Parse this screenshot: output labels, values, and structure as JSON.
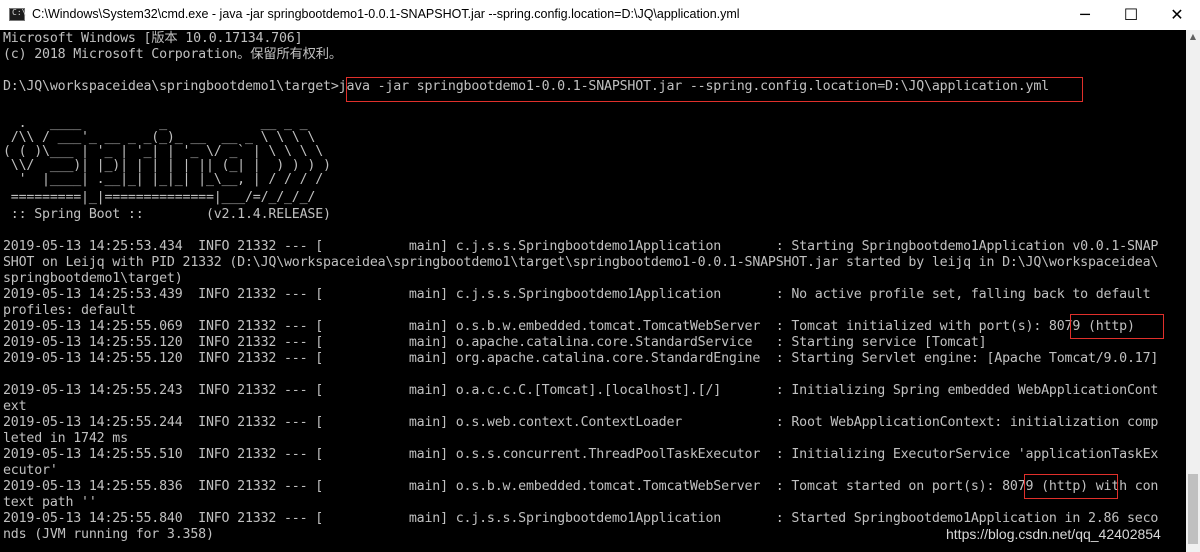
{
  "window": {
    "title": "C:\\Windows\\System32\\cmd.exe - java  -jar springbootdemo1-0.0.1-SNAPSHOT.jar --spring.config.location=D:\\JQ\\application.yml",
    "icon": "cmd-icon",
    "icon_text": "C:\\",
    "minimize_label": "─",
    "maximize_label": "☐",
    "close_label": "✕"
  },
  "console": {
    "lines": [
      "Microsoft Windows [版本 10.0.17134.706]",
      "(c) 2018 Microsoft Corporation。保留所有权利。",
      "",
      "D:\\JQ\\workspaceidea\\springbootdemo1\\target>java -jar springbootdemo1-0.0.1-SNAPSHOT.jar --spring.config.location=D:\\JQ\\application.yml",
      "",
      "  .   ____          _            __ _ _",
      " /\\\\ / ___'_ __ _ _(_)_ __  __ _ \\ \\ \\ \\",
      "( ( )\\___ | '_ | '_| | '_ \\/ _` | \\ \\ \\ \\",
      " \\\\/  ___)| |_)| | | | | || (_| |  ) ) ) )",
      "  '  |____| .__|_| |_|_| |_\\__, | / / / /",
      " =========|_|==============|___/=/_/_/_/",
      " :: Spring Boot ::        (v2.1.4.RELEASE)",
      "",
      "2019-05-13 14:25:53.434  INFO 21332 --- [           main] c.j.s.s.Springbootdemo1Application       : Starting Springbootdemo1Application v0.0.1-SNAP",
      "SHOT on Leijq with PID 21332 (D:\\JQ\\workspaceidea\\springbootdemo1\\target\\springbootdemo1-0.0.1-SNAPSHOT.jar started by leijq in D:\\JQ\\workspaceidea\\",
      "springbootdemo1\\target)",
      "2019-05-13 14:25:53.439  INFO 21332 --- [           main] c.j.s.s.Springbootdemo1Application       : No active profile set, falling back to default",
      "profiles: default",
      "2019-05-13 14:25:55.069  INFO 21332 --- [           main] o.s.b.w.embedded.tomcat.TomcatWebServer  : Tomcat initialized with port(s): 8079 (http)",
      "2019-05-13 14:25:55.120  INFO 21332 --- [           main] o.apache.catalina.core.StandardService   : Starting service [Tomcat]",
      "2019-05-13 14:25:55.120  INFO 21332 --- [           main] org.apache.catalina.core.StandardEngine  : Starting Servlet engine: [Apache Tomcat/9.0.17]",
      "",
      "2019-05-13 14:25:55.243  INFO 21332 --- [           main] o.a.c.c.C.[Tomcat].[localhost].[/]       : Initializing Spring embedded WebApplicationCont",
      "ext",
      "2019-05-13 14:25:55.244  INFO 21332 --- [           main] o.s.web.context.ContextLoader            : Root WebApplicationContext: initialization comp",
      "leted in 1742 ms",
      "2019-05-13 14:25:55.510  INFO 21332 --- [           main] o.s.s.concurrent.ThreadPoolTaskExecutor  : Initializing ExecutorService 'applicationTaskEx",
      "ecutor'",
      "2019-05-13 14:25:55.836  INFO 21332 --- [           main] o.s.b.w.embedded.tomcat.TomcatWebServer  : Tomcat started on port(s): 8079 (http) with con",
      "text path ''",
      "2019-05-13 14:25:55.840  INFO 21332 --- [           main] c.j.s.s.Springbootdemo1Application       : Started Springbootdemo1Application in 2.86 seco",
      "nds (JVM running for 3.358)"
    ]
  },
  "watermark": "https://blog.csdn.net/qq_42402854",
  "colors": {
    "console_bg": "#000000",
    "console_text": "#c0c0c0",
    "highlight": "#e0302b"
  }
}
